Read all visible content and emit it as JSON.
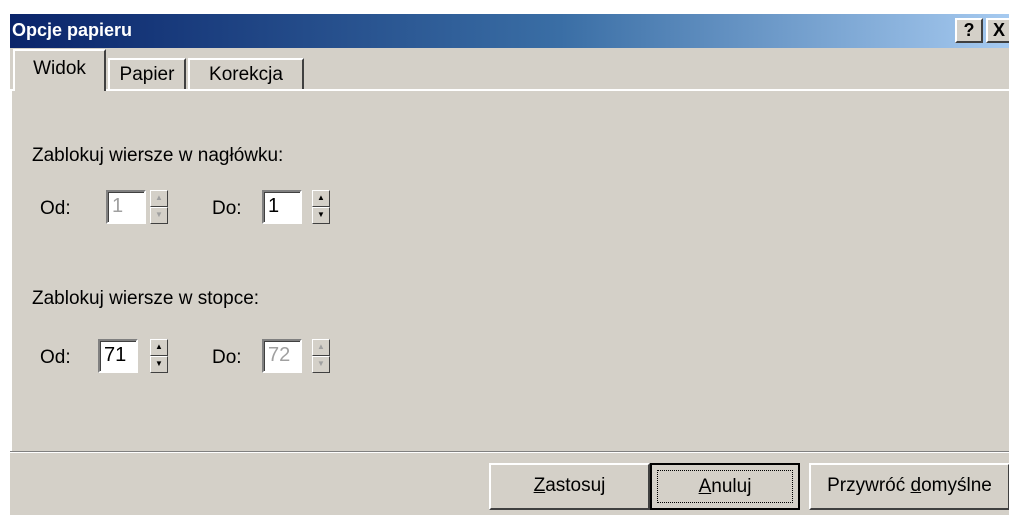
{
  "window": {
    "title": "Opcje papieru",
    "help_label": "?",
    "close_label": "X"
  },
  "tabs": [
    {
      "label": "Widok",
      "active": true
    },
    {
      "label": "Papier",
      "active": false
    },
    {
      "label": "Korekcja",
      "active": false
    }
  ],
  "header_section": {
    "title": "Zablokuj wiersze w nagłówku:",
    "from_label": "Od:",
    "from_value": "1",
    "from_enabled": false,
    "to_label": "Do:",
    "to_value": "1",
    "to_enabled": true
  },
  "footer_section": {
    "title": "Zablokuj wiersze w stopce:",
    "from_label": "Od:",
    "from_value": "71",
    "from_enabled": true,
    "to_label": "Do:",
    "to_value": "72",
    "to_enabled": false
  },
  "buttons": {
    "apply": {
      "mnemonic": "Z",
      "rest": "astosuj"
    },
    "cancel": {
      "mnemonic": "A",
      "rest": "nuluj"
    },
    "restore": {
      "prefix": "Przywróć ",
      "mnemonic": "d",
      "rest": "omyślne"
    }
  },
  "colors": {
    "titlebar_start": "#0a246a",
    "titlebar_end": "#a6caf0",
    "dialog_face": "#d4d0c8"
  }
}
